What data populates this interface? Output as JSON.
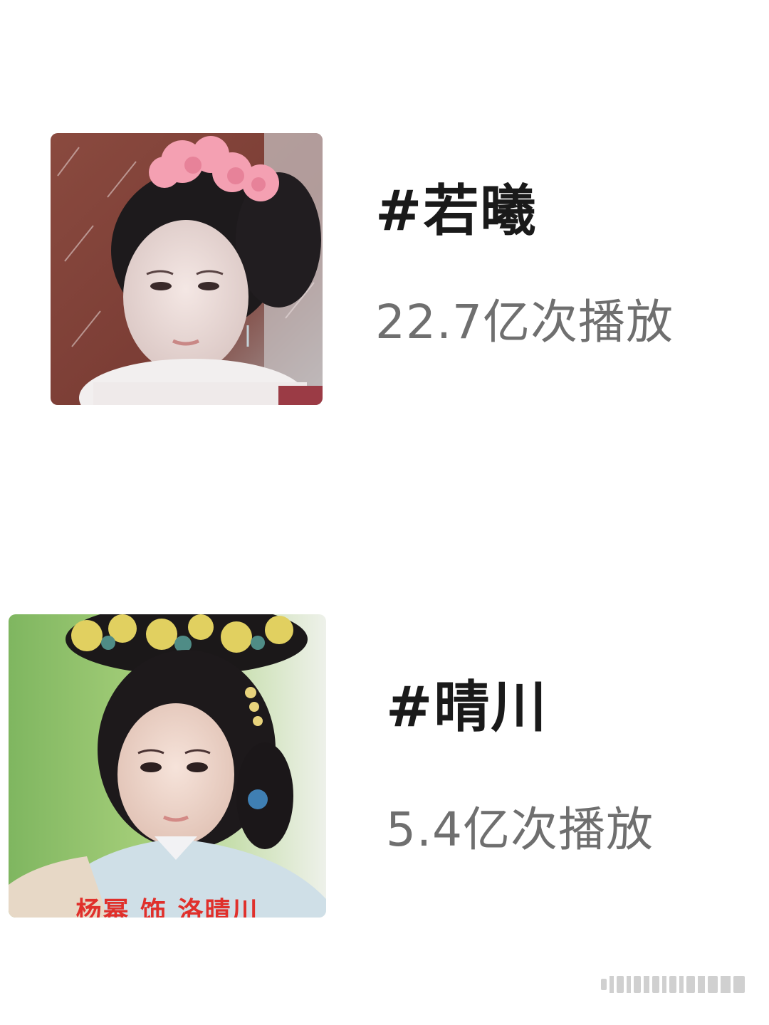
{
  "items": [
    {
      "tag": "#若曦",
      "plays": "22.7亿次播放"
    },
    {
      "tag": "#晴川",
      "plays": "5.4亿次播放",
      "thumb_caption": "杨幂 饰 洛晴川"
    }
  ],
  "colors": {
    "title": "#1a1a1a",
    "plays": "#6f6f6f",
    "caption": "#e0302b"
  }
}
